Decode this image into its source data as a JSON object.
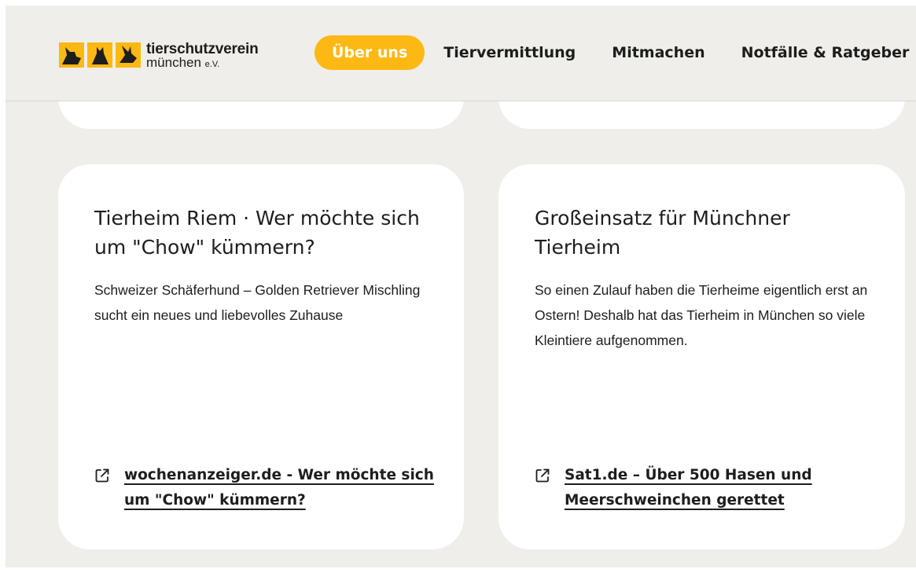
{
  "brand": {
    "line1": "tierschutzverein",
    "line2": "münchen",
    "suffix": "e.V.",
    "accent_color": "#fdb813"
  },
  "nav": {
    "items": [
      {
        "label": "Über uns",
        "active": true
      },
      {
        "label": "Tiervermittlung",
        "active": false
      },
      {
        "label": "Mitmachen",
        "active": false
      },
      {
        "label": "Notfälle & Ratgeber",
        "active": false
      }
    ]
  },
  "cards": [
    {
      "title": "Tierheim Riem · Wer möchte sich um \"Chow\" kümmern?",
      "body": "Schweizer Schäferhund – Golden Retriever Mischling sucht ein neues und liebevolles Zuhause",
      "link": "wochenanzeiger.de - Wer möchte sich um \"Chow\" kümmern?",
      "link_icon": "external-link-icon"
    },
    {
      "title": "Großeinsatz für Münchner Tierheim",
      "body": "So einen Zulauf haben die Tierheime eigentlich erst an Ostern! Deshalb hat das Tierheim in München so viele Kleintiere aufgenommen.",
      "link": "Sat1.de – Über 500 Hasen und Meerschweinchen gerettet",
      "link_icon": "external-link-icon"
    }
  ],
  "colors": {
    "page_background": "#efeeea",
    "card_background": "#ffffff",
    "text": "#1d1d1b"
  }
}
